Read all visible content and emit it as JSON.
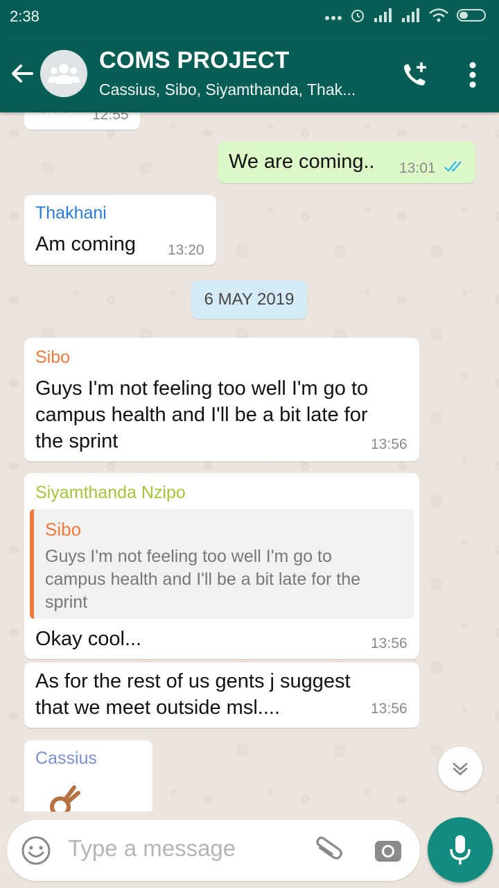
{
  "status_bar": {
    "time": "2:38"
  },
  "header": {
    "title": "COMS PROJECT",
    "subtitle": "Cassius, Sibo, Siyamthanda, Thak..."
  },
  "messages": [
    {
      "direction": "in",
      "text": "Cool",
      "time": "12:55"
    },
    {
      "direction": "out",
      "text": "We are coming..",
      "time": "13:01",
      "status": "read"
    },
    {
      "direction": "in",
      "sender": "Thakhani",
      "sender_color": "#2A7BD8",
      "text": "Am coming",
      "time": "13:20"
    },
    {
      "type": "date",
      "text": "6 MAY 2019"
    },
    {
      "direction": "in",
      "sender": "Sibo",
      "sender_color": "#F07A3C",
      "lines": [
        "Guys I'm not feeling too well I'm go to",
        "campus health and I'll be a bit late for",
        "the sprint"
      ],
      "time": "13:56"
    },
    {
      "direction": "in",
      "sender": "Siyamthanda Nzipo",
      "sender_color": "#A5C33B",
      "reply": {
        "sender": "Sibo",
        "lines": [
          "Guys I'm not feeling too well I'm go to",
          "campus health and I'll be a bit late for the",
          "sprint"
        ]
      },
      "text": "Okay cool...",
      "time": "13:56"
    },
    {
      "direction": "in",
      "lines": [
        "As for the rest of us gents j suggest",
        "that we meet outside msl...."
      ],
      "time": "13:56"
    },
    {
      "direction": "in",
      "sender": "Cassius",
      "sender_color": "#7B8FD1",
      "text": ""
    }
  ],
  "input": {
    "placeholder": "Type a message"
  },
  "icons": {
    "back": "arrow-left-icon",
    "group_avatar": "group-icon",
    "add_call": "add-call-icon",
    "more": "more-vert-icon",
    "scroll_down": "double-chevron-down-icon",
    "emoji": "emoji-icon",
    "attach": "paperclip-icon",
    "camera": "camera-icon",
    "mic": "mic-icon"
  },
  "colors": {
    "primary": "#075E54",
    "accent": "#128C7E",
    "outgoing_bubble": "#DCF8C6",
    "read_ticks": "#34B7F1"
  }
}
